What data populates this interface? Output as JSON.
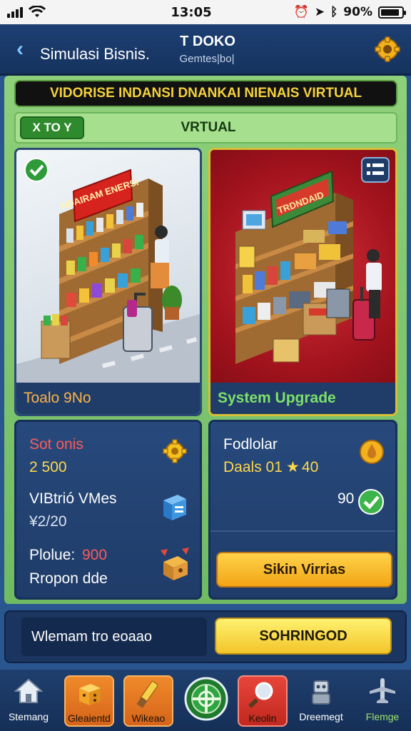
{
  "status_bar": {
    "time": "13:05",
    "battery_text": "90%",
    "battery_level": 0.9
  },
  "header": {
    "title": "Simulasi Bisnis.",
    "shop_name": "T DOKO",
    "shop_sub": "Gemtes|bo|"
  },
  "banner": {
    "text": "VIDORISE INDANSI DNANKAI NIENAIS VIRTUAL"
  },
  "filter": {
    "chip_label": "X TO Y",
    "label": "VRTUAL"
  },
  "cards": [
    {
      "label": "Toalo 9No",
      "sign_text": "NDAIRAM ENERSI"
    },
    {
      "label": "System Upgrade",
      "sign_text": "TRDNDAID"
    }
  ],
  "info_left": {
    "stat1_label": "Sot onis",
    "stat1_value": "2 500",
    "stat2_label": "VIBtrió VMes",
    "stat2_value": "¥2/20",
    "stat3_label": "Plolue:",
    "stat3_value": "900",
    "stat4_label": "Rropon dde"
  },
  "info_right": {
    "title": "Fodlolar",
    "line": "Daals 01",
    "star_value": "40",
    "progress_value": "90",
    "sale_button": "Sikin Virrias"
  },
  "bottom": {
    "input_text": "Wlemam tro eoaao",
    "submit_label": "SOHRINGOD"
  },
  "nav": [
    {
      "label": "Stemang",
      "icon": "home-icon"
    },
    {
      "label": "Gleaientd",
      "icon": "dice-icon"
    },
    {
      "label": "Wikeao",
      "icon": "hammer-icon"
    },
    {
      "label": "",
      "icon": "center-target-icon"
    },
    {
      "label": "Keolin",
      "icon": "magnifier-icon"
    },
    {
      "label": "Dreemegt",
      "icon": "robot-icon"
    },
    {
      "label": "Flemge",
      "icon": "plane-icon"
    }
  ]
}
